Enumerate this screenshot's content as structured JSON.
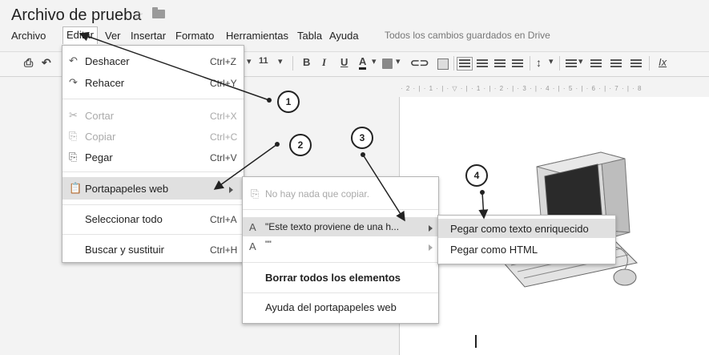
{
  "header": {
    "title": "Archivo de prueba",
    "star_icon": "☆"
  },
  "menubar": {
    "items": [
      "Archivo",
      "Editar",
      "Ver",
      "Insertar",
      "Formato",
      "Herramientas",
      "Tabla",
      "Ayuda"
    ],
    "status": "Todos los cambios guardados en Drive"
  },
  "toolbar": {
    "font_size": "11",
    "bold": "B",
    "italic": "I",
    "underline": "U",
    "text_color": "A",
    "clear_format": "Ix"
  },
  "ruler": {
    "text": "· 2 · | · 1 · | · ▽ · | · 1 · | · 2 · | · 3 · | · 4 · | · 5 · | · 6 · | · 7 · | · 8"
  },
  "edit_menu": {
    "undo": {
      "label": "Deshacer",
      "shortcut": "Ctrl+Z"
    },
    "redo": {
      "label": "Rehacer",
      "shortcut": "Ctrl+Y"
    },
    "cut": {
      "label": "Cortar",
      "shortcut": "Ctrl+X"
    },
    "copy": {
      "label": "Copiar",
      "shortcut": "Ctrl+C"
    },
    "paste": {
      "label": "Pegar",
      "shortcut": "Ctrl+V"
    },
    "web_clipboard": {
      "label": "Portapapeles web"
    },
    "select_all": {
      "label": "Seleccionar todo",
      "shortcut": "Ctrl+A"
    },
    "find_replace": {
      "label": "Buscar y sustituir",
      "shortcut": "Ctrl+H"
    }
  },
  "clipboard_menu": {
    "nothing_to_copy": "No hay nada que copiar.",
    "item1": "\"Este texto proviene de una h...",
    "item2": "\"\"",
    "clear_all": "Borrar todos los elementos",
    "help": "Ayuda del portapapeles web",
    "type_icon": "A"
  },
  "paste_menu": {
    "rich": "Pegar como texto enriquecido",
    "html": "Pegar como HTML"
  },
  "callouts": [
    "1",
    "2",
    "3",
    "4"
  ]
}
